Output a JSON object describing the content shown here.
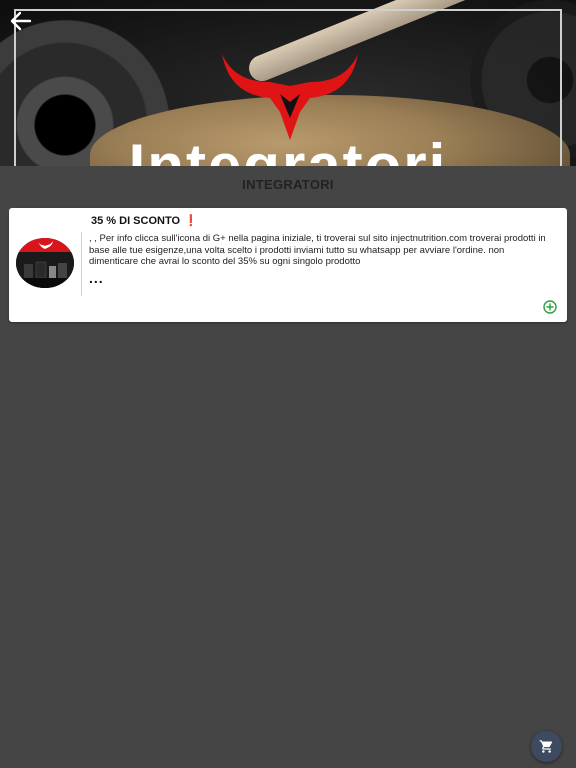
{
  "header": {
    "banner_text": "Integratori",
    "back_icon": "arrow-left-icon",
    "logo_icon": "bull-horns-logo-icon"
  },
  "section": {
    "title": "INTEGRATORI"
  },
  "items": [
    {
      "title": "35 % DI SCONTO",
      "badge": "❗",
      "description": ", , Per info clicca sull'icona di G+ nella pagina iniziale, ti troverai sul sito injectnutrition.com troverai prodotti in base alle tue esigenze,una volta scelto i prodotti inviami tutto su whatsapp per avviare l'ordine. non dimenticare che avrai lo sconto del 35% su ogni singolo prodotto",
      "more": "...",
      "add_icon": "plus-circle-icon"
    }
  ],
  "cart": {
    "icon": "shopping-cart-icon"
  },
  "colors": {
    "background": "#454545",
    "card": "#ffffff",
    "accent_red": "#d8141c",
    "add_green": "#2e9e3e",
    "cart_button": "#3e4a60"
  }
}
